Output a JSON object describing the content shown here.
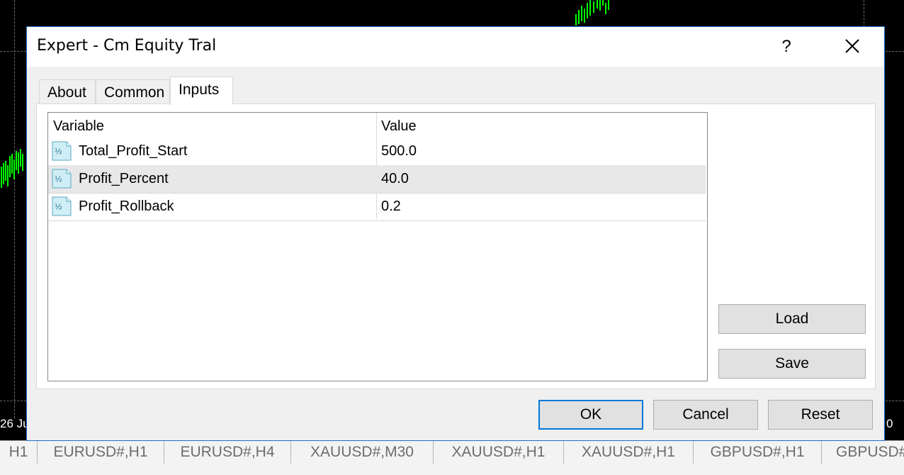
{
  "background": {
    "date_left": "26 Ju",
    "date_right": "0",
    "symbol_tabs": [
      "H1",
      "EURUSD#,H1",
      "EURUSD#,H4",
      "XAUUSD#,M30",
      "XAUUSD#,H1",
      "XAUUSD#,H1",
      "GBPUSD#,H1",
      "GBPUSD#"
    ]
  },
  "dialog": {
    "title": "Expert - Cm Equity Tral",
    "help_label": "?",
    "tabs": [
      {
        "label": "About"
      },
      {
        "label": "Common"
      },
      {
        "label": "Inputs"
      }
    ],
    "table": {
      "headers": {
        "variable": "Variable",
        "value": "Value"
      },
      "rows": [
        {
          "variable": "Total_Profit_Start",
          "value": "500.0"
        },
        {
          "variable": "Profit_Percent",
          "value": "40.0"
        },
        {
          "variable": "Profit_Rollback",
          "value": "0.2"
        }
      ]
    },
    "side_buttons": {
      "load": "Load",
      "save": "Save"
    },
    "footer_buttons": {
      "ok": "OK",
      "cancel": "Cancel",
      "reset": "Reset"
    }
  },
  "colors": {
    "chart_background": "#000000",
    "candles": "#00ff00",
    "dialog_border": "#1f6fd0",
    "default_button_border": "#0078d7"
  },
  "icons": {
    "variable_type": "double-variable-icon",
    "close": "close-icon"
  }
}
